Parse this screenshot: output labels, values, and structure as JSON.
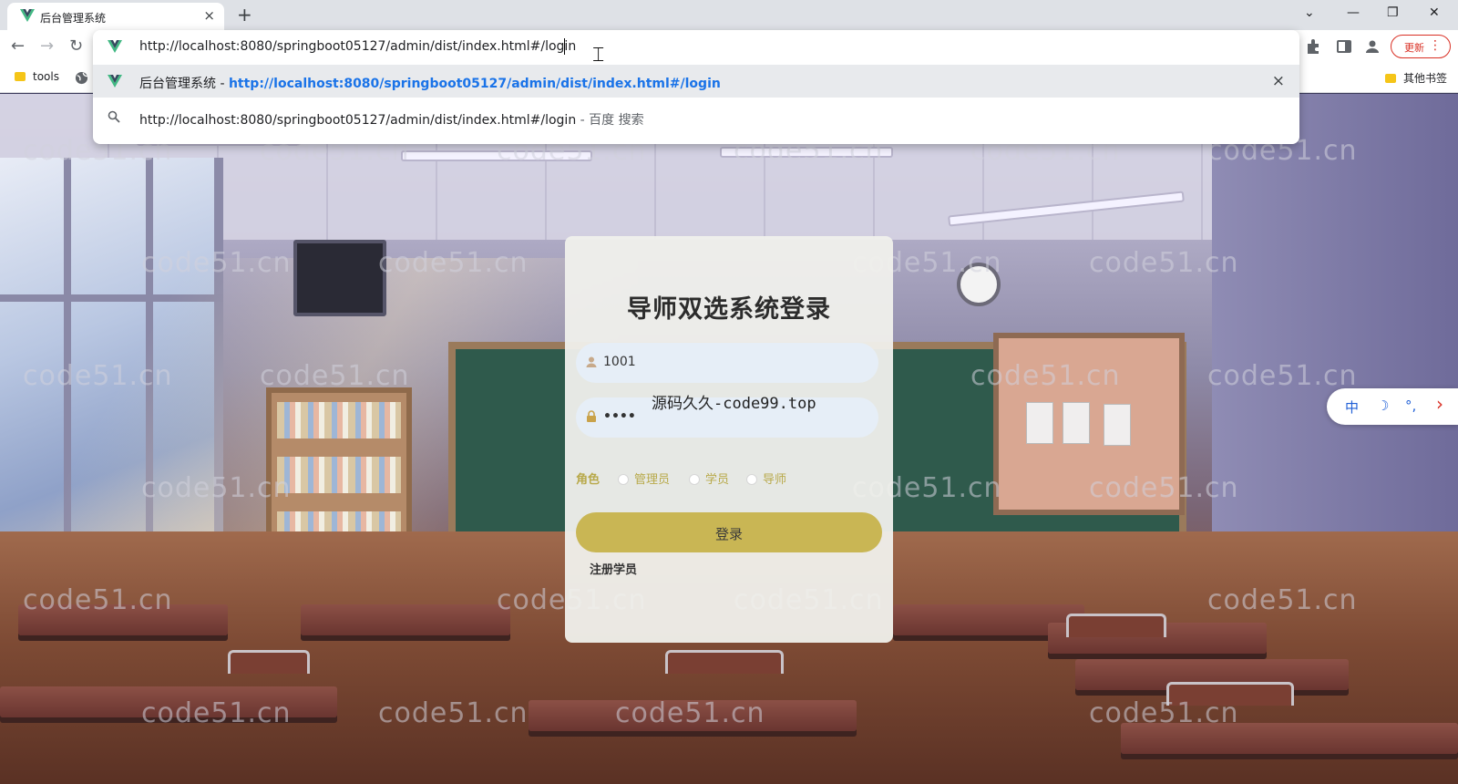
{
  "browser": {
    "tab_title": "后台管理系统",
    "tab_close": "×",
    "new_tab": "+",
    "url": "http://localhost:8080/springboot05127/admin/dist/index.html#/login",
    "update_label": "更新",
    "update_menu": "⋮",
    "bookmarks": {
      "tools": "tools",
      "other": "其他书签"
    },
    "suggestion": {
      "title": "后台管理系统",
      "separator": " - ",
      "url": "http://localhost:8080/springboot05127/admin/dist/index.html#/login",
      "remove": "×"
    },
    "search_suggestion": {
      "query": "http://localhost:8080/springboot05127/admin/dist/index.html#/login",
      "suffix": " - 百度 搜索"
    },
    "nav": {
      "back": "←",
      "forward": "→",
      "reload": "↻"
    },
    "window": {
      "menu": "⌄",
      "minimize": "—",
      "restore": "❐",
      "close": "✕"
    }
  },
  "watermark_text": "code51.cn",
  "overlay_text": "源码久久-code99.top",
  "login": {
    "title": "导师双选系统登录",
    "username_value": "1001",
    "password_value": "••••",
    "role_label": "角色",
    "roles": [
      "管理员",
      "学员",
      "导师"
    ],
    "login_button": "登录",
    "register_link": "注册学员"
  },
  "ime": {
    "lang": "中",
    "moon": "☽",
    "punct": "°,",
    "arrow": "›"
  },
  "colors": {
    "accent_button": "#c9b654",
    "role_text": "#b8a94a",
    "link_blue": "#1a73e8",
    "update_red": "#d93025"
  }
}
